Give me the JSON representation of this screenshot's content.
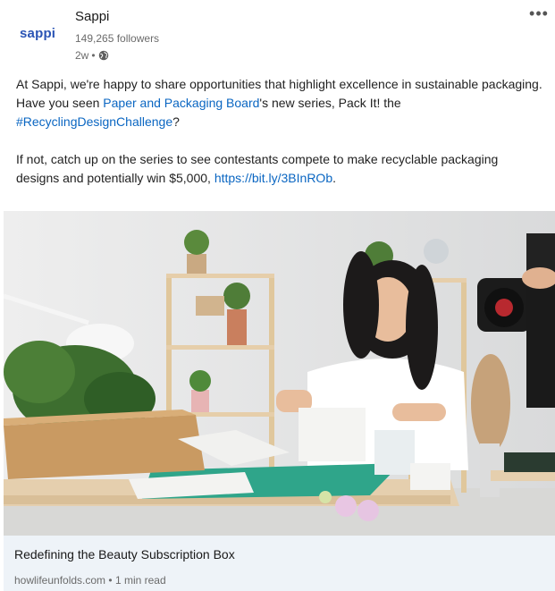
{
  "company": {
    "logo_text": "sappi",
    "name": "Sappi",
    "followers": "149,265 followers",
    "time_ago": "2w",
    "separator": "•",
    "visibility_icon": "globe-icon"
  },
  "menu": {
    "more_label": "•••"
  },
  "post": {
    "p1_before": "At Sappi, we're happy to share opportunities that highlight excellence in sustainable packaging. Have you seen ",
    "p1_link": "Paper and Packaging Board",
    "p1_middle": "'s new series, Pack It! the ",
    "p1_hashtag": "#RecyclingDesignChallenge",
    "p1_end": "?",
    "p2_before": "If not, catch up on the series to see contestants compete to make recyclable packaging designs and potentially win $5,000, ",
    "p2_url": "https://bit.ly/3BInROb",
    "p2_end": "."
  },
  "image": {
    "alt_icon": "photo-woman-folding-boxes"
  },
  "link_preview": {
    "title": "Redefining the Beauty Subscription Box",
    "source": "howlifeunfolds.com",
    "separator": "•",
    "read_time": "1 min read"
  },
  "colors": {
    "link": "#0a66c2",
    "logo": "#2a54b5",
    "preview_bg": "#eef3f8"
  }
}
